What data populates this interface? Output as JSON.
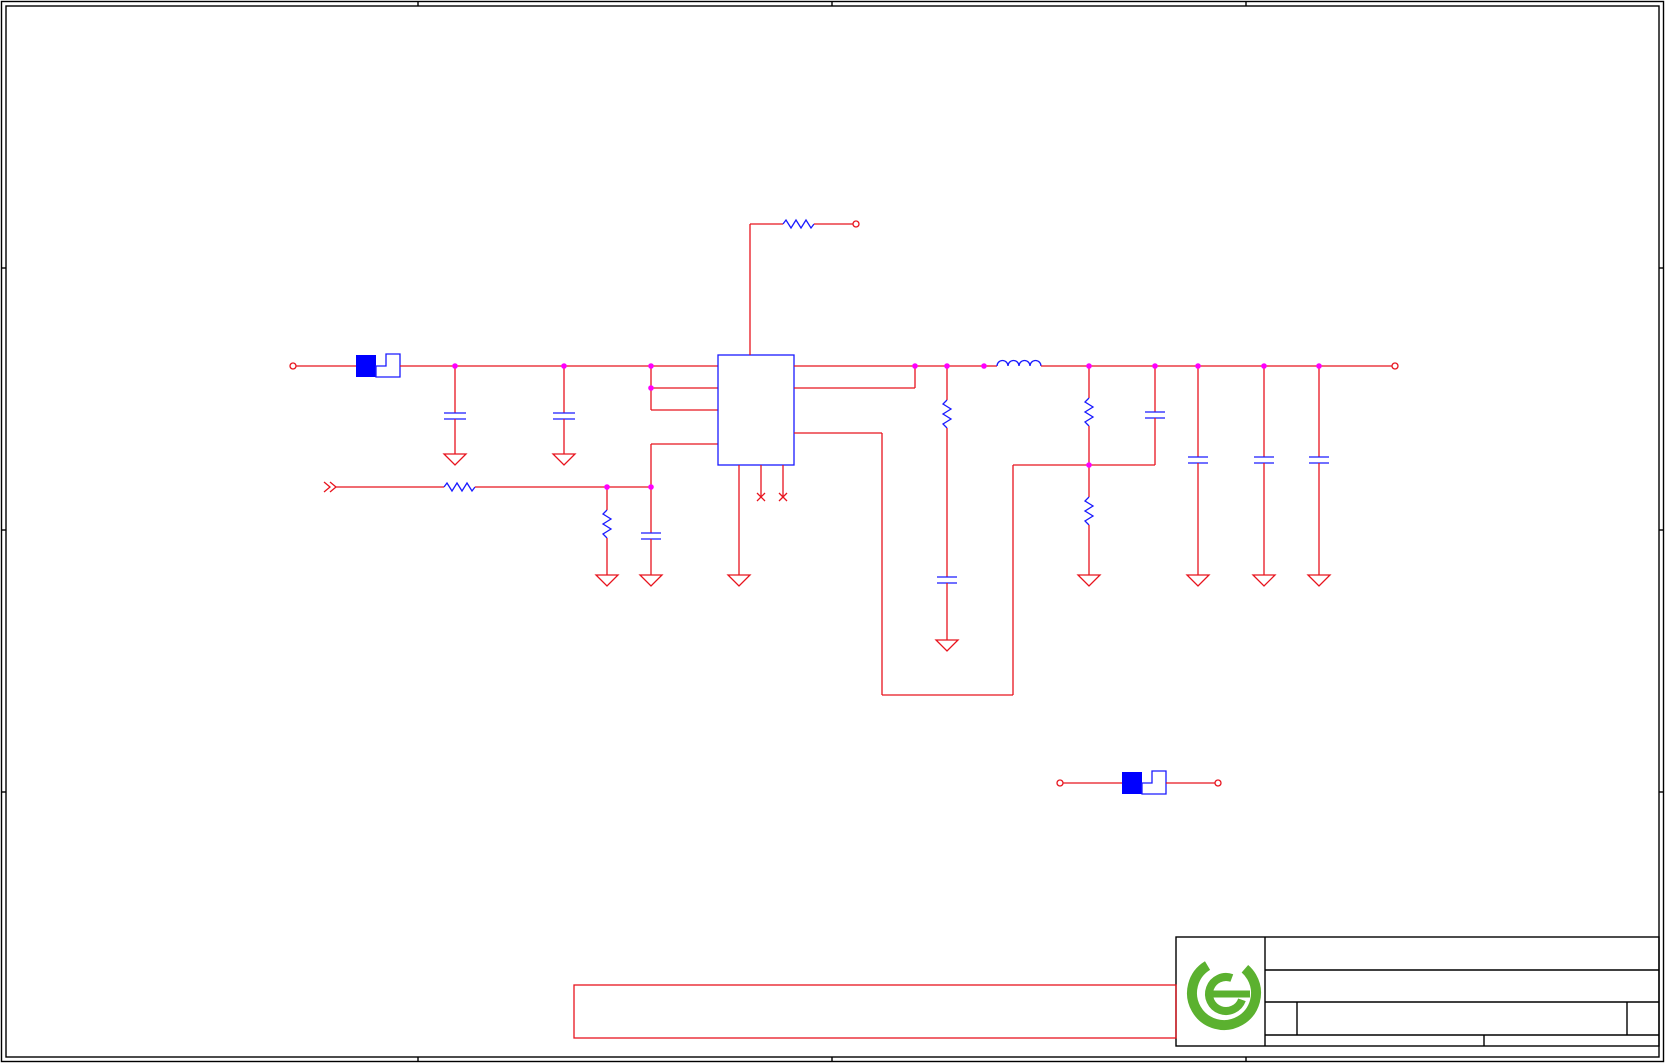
{
  "sheet": {
    "page_number_label": "",
    "title_block": {
      "title": "",
      "document": "",
      "size": "",
      "rev": "",
      "date": "",
      "sheet": ""
    },
    "logo": {
      "name": "green-e-logo",
      "color": "#5bb12f"
    },
    "notes_box": {
      "text": ""
    }
  },
  "colors": {
    "wire": "#e8141e",
    "component_body": "#1a1aff",
    "junction": "#ff00ff",
    "frame": "#000000",
    "logo_green": "#5bb12f"
  }
}
